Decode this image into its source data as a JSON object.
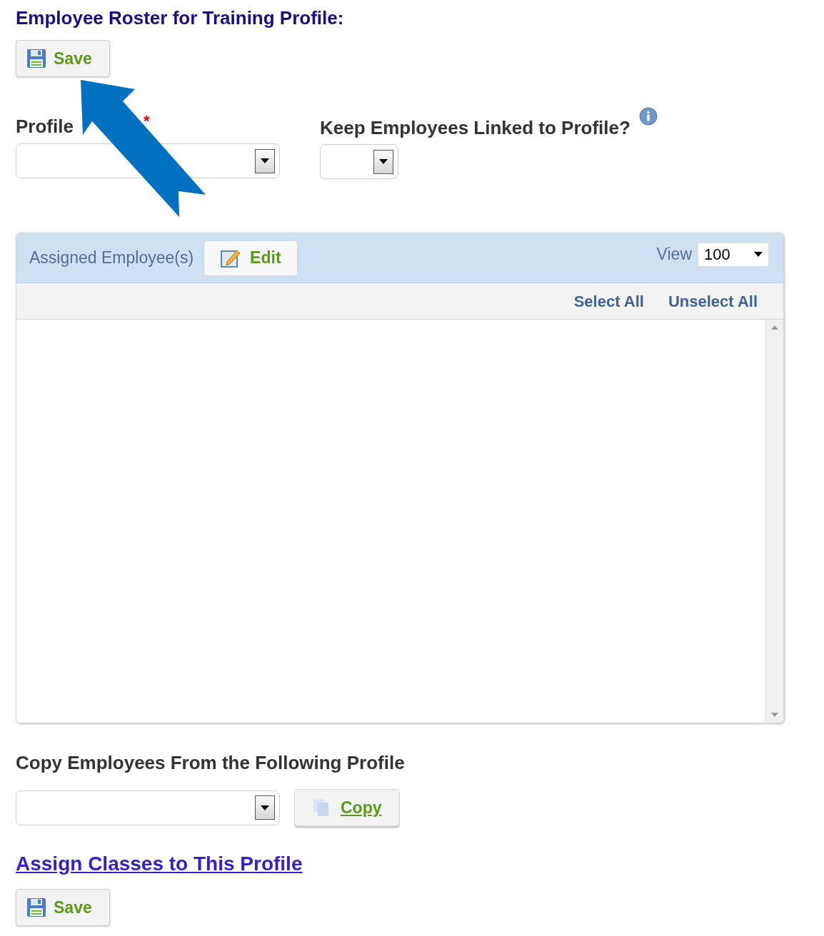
{
  "title": "Employee Roster for Training Profile:",
  "top_save_button": {
    "label": "Save"
  },
  "profile_name": {
    "label": "Profile",
    "required_mark": "*"
  },
  "keep_linked": {
    "label": "Keep Employees Linked to Profile?"
  },
  "panel": {
    "title": "Assigned Employee(s)",
    "edit_button": {
      "label": "Edit"
    },
    "view_label": "View",
    "view_value": "100",
    "select_all": "Select All",
    "unselect_all": "Unselect All"
  },
  "copy": {
    "label": "Copy Employees From the Following Profile",
    "button": "Copy"
  },
  "assign_link": "Assign Classes to This Profile",
  "bottom_save_button": {
    "label": "Save"
  }
}
